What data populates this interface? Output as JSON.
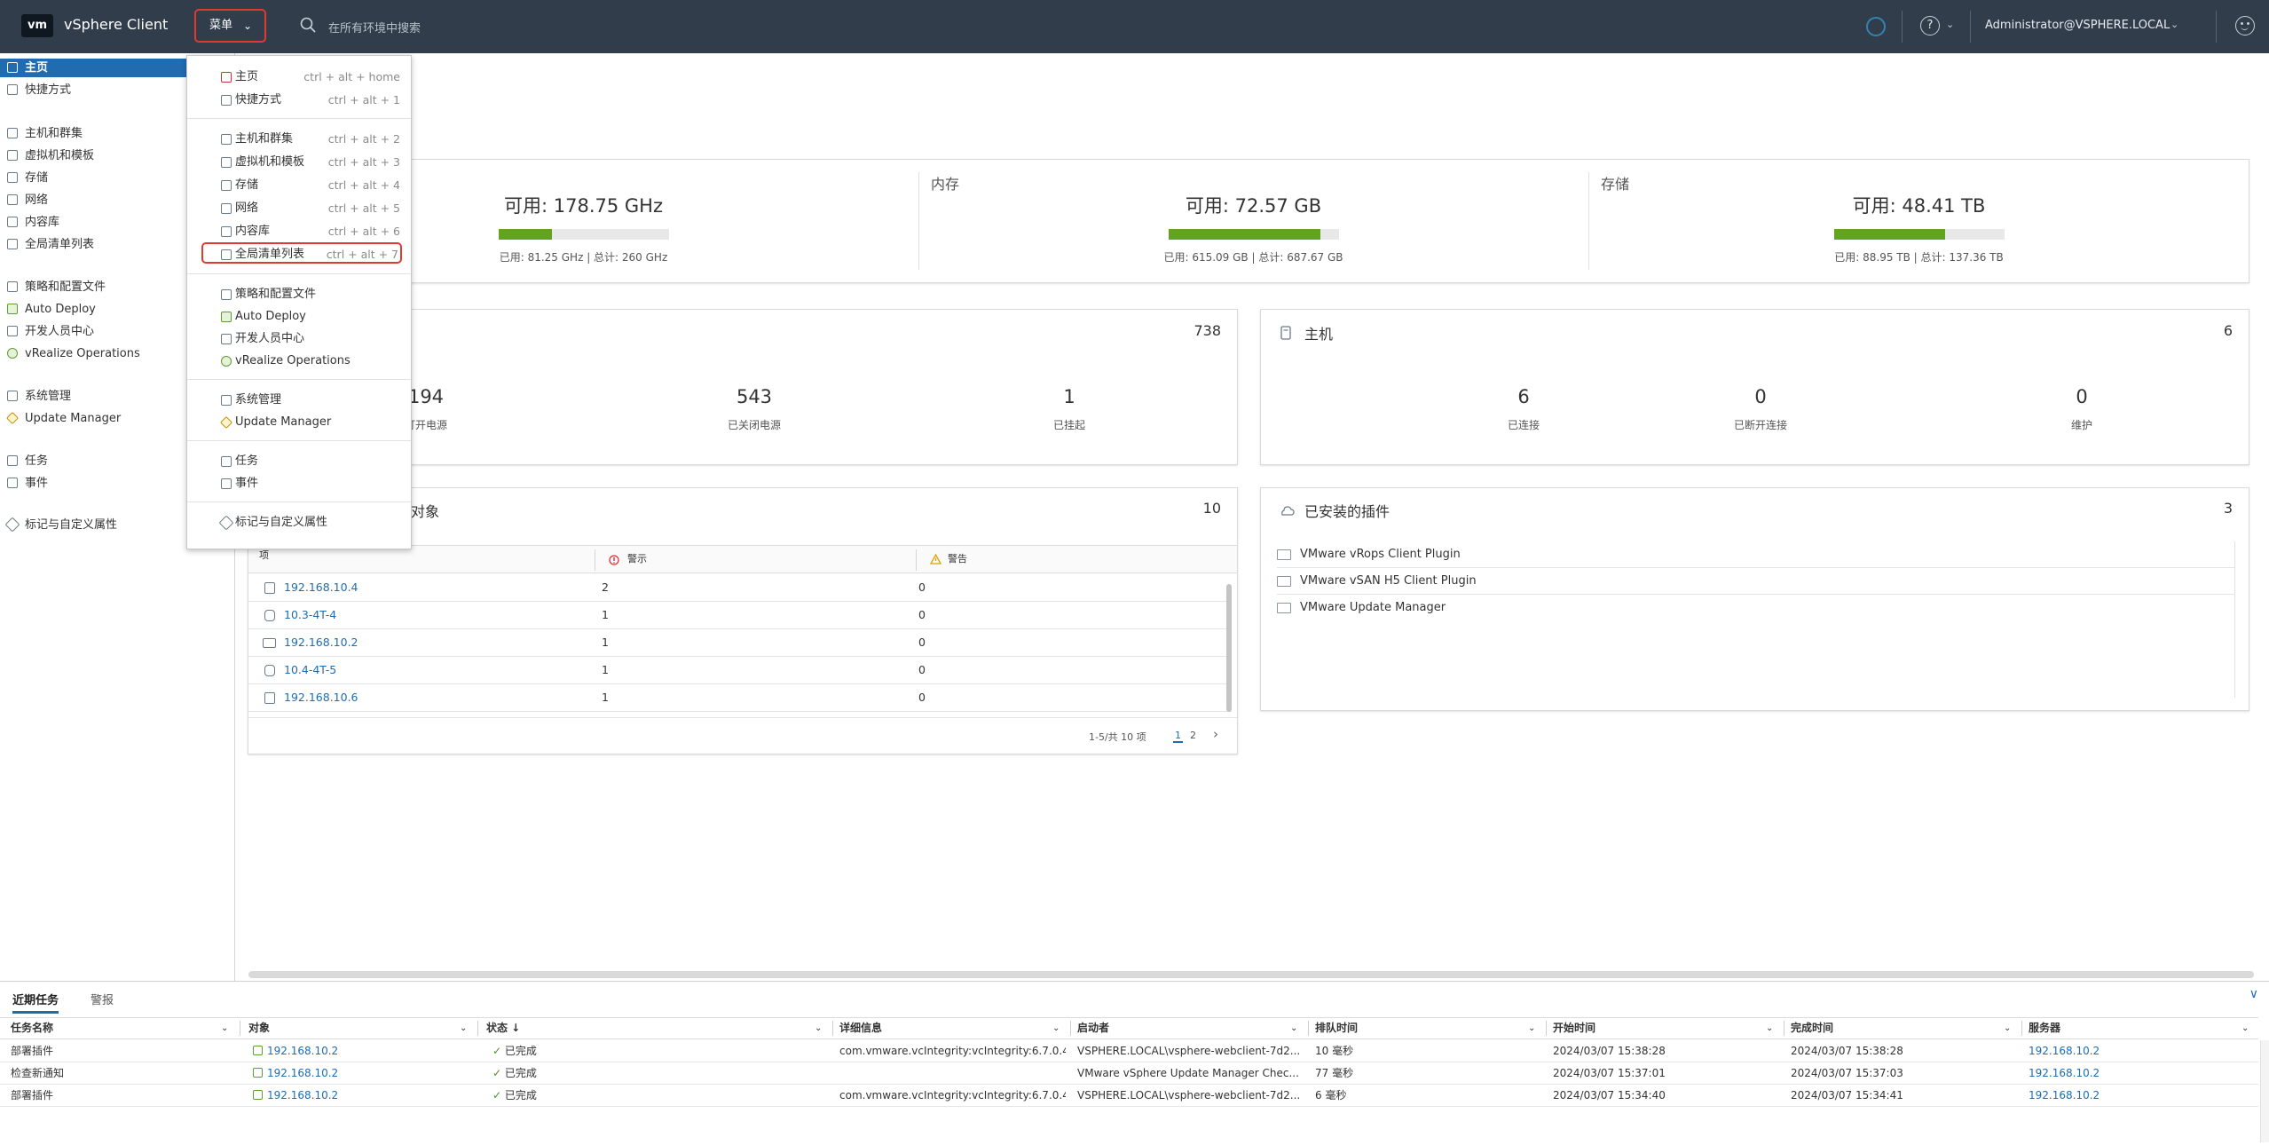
{
  "header": {
    "logo": "vm",
    "title": "vSphere Client",
    "menu_label": "菜单",
    "search_placeholder": "在所有环境中搜索",
    "user": "Administrator@VSPHERE.LOCAL",
    "help": "?"
  },
  "sidebar": {
    "items": [
      {
        "label": "主页"
      },
      {
        "label": "快捷方式"
      },
      {
        "label": "主机和群集"
      },
      {
        "label": "虚拟机和模板"
      },
      {
        "label": "存储"
      },
      {
        "label": "网络"
      },
      {
        "label": "内容库"
      },
      {
        "label": "全局清单列表"
      },
      {
        "label": "策略和配置文件"
      },
      {
        "label": "Auto Deploy"
      },
      {
        "label": "开发人员中心"
      },
      {
        "label": "vRealize Operations"
      },
      {
        "label": "系统管理"
      },
      {
        "label": "Update Manager"
      },
      {
        "label": "任务"
      },
      {
        "label": "事件"
      },
      {
        "label": "标记与自定义属性"
      }
    ]
  },
  "menu": {
    "items": [
      {
        "label": "主页",
        "shortcut": "ctrl + alt + home"
      },
      {
        "label": "快捷方式",
        "shortcut": "ctrl + alt + 1"
      },
      {
        "label": "主机和群集",
        "shortcut": "ctrl + alt + 2"
      },
      {
        "label": "虚拟机和模板",
        "shortcut": "ctrl + alt + 3"
      },
      {
        "label": "存储",
        "shortcut": "ctrl + alt + 4"
      },
      {
        "label": "网络",
        "shortcut": "ctrl + alt + 5"
      },
      {
        "label": "内容库",
        "shortcut": "ctrl + alt + 6"
      },
      {
        "label": "全局清单列表",
        "shortcut": "ctrl + alt + 7"
      },
      {
        "label": "策略和配置文件",
        "shortcut": ""
      },
      {
        "label": "Auto Deploy",
        "shortcut": ""
      },
      {
        "label": "开发人员中心",
        "shortcut": ""
      },
      {
        "label": "vRealize Operations",
        "shortcut": ""
      },
      {
        "label": "系统管理",
        "shortcut": ""
      },
      {
        "label": "Update Manager",
        "shortcut": ""
      },
      {
        "label": "任务",
        "shortcut": ""
      },
      {
        "label": "事件",
        "shortcut": ""
      },
      {
        "label": "标记与自定义属性",
        "shortcut": ""
      }
    ]
  },
  "resources": {
    "cpu": {
      "free": "可用: 178.75 GHz",
      "detail": "已用: 81.25 GHz | 总计: 260 GHz",
      "used_pct": 31
    },
    "memory": {
      "label": "内存",
      "free": "可用: 72.57 GB",
      "detail": "已用: 615.09 GB | 总计: 687.67 GB",
      "used_pct": 89
    },
    "storage": {
      "label": "存储",
      "free": "可用: 48.41 TB",
      "detail": "已用: 88.95 TB | 总计: 137.36 TB",
      "used_pct": 65
    }
  },
  "vms": {
    "count": "738",
    "stats": [
      {
        "value": "194",
        "label": "打开电源"
      },
      {
        "value": "543",
        "label": "已关闭电源"
      },
      {
        "value": "1",
        "label": "已挂起"
      }
    ]
  },
  "hosts": {
    "title": "主机",
    "count": "6",
    "stats": [
      {
        "value": "6",
        "label": "已连接"
      },
      {
        "value": "0",
        "label": "已断开连接"
      },
      {
        "value": "0",
        "label": "维护"
      }
    ]
  },
  "objects": {
    "title": "对象",
    "count": "10",
    "columns": [
      "项",
      "警示",
      "警告"
    ],
    "rows": [
      {
        "name": "192.168.10.4",
        "alerts": "2",
        "warnings": "0"
      },
      {
        "name": "10.3-4T-4",
        "alerts": "1",
        "warnings": "0"
      },
      {
        "name": "192.168.10.2",
        "alerts": "1",
        "warnings": "0"
      },
      {
        "name": "10.4-4T-5",
        "alerts": "1",
        "warnings": "0"
      },
      {
        "name": "192.168.10.6",
        "alerts": "1",
        "warnings": "0"
      }
    ],
    "pager_text": "1-5/共 10 项",
    "pages": [
      "1",
      "2"
    ]
  },
  "plugins": {
    "title": "已安装的插件",
    "count": "3",
    "items": [
      "VMware vRops Client Plugin",
      "VMware vSAN H5 Client Plugin",
      "VMware Update Manager"
    ]
  },
  "tasks": {
    "tabs": [
      "近期任务",
      "警报"
    ],
    "columns": [
      "任务名称",
      "对象",
      "状态 ↓",
      "详细信息",
      "启动者",
      "排队时间",
      "开始时间",
      "完成时间",
      "服务器"
    ],
    "rows": [
      {
        "name": "部署插件",
        "object": "192.168.10.2",
        "status": "已完成",
        "detail": "com.vmware.vcIntegrity:vcIntegrity:6.7.0.4...",
        "initiator": "VSPHERE.LOCAL\\vsphere-webclient-7d2...",
        "queued": "10 毫秒",
        "start": "2024/03/07 15:38:28",
        "end": "2024/03/07 15:38:28",
        "server": "192.168.10.2"
      },
      {
        "name": "检查新通知",
        "object": "192.168.10.2",
        "status": "已完成",
        "detail": "",
        "initiator": "VMware vSphere Update Manager Chec...",
        "queued": "77 毫秒",
        "start": "2024/03/07 15:37:01",
        "end": "2024/03/07 15:37:03",
        "server": "192.168.10.2"
      },
      {
        "name": "部署插件",
        "object": "192.168.10.2",
        "status": "已完成",
        "detail": "com.vmware.vcIntegrity:vcIntegrity:6.7.0.4...",
        "initiator": "VSPHERE.LOCAL\\vsphere-webclient-7d2...",
        "queued": "6 毫秒",
        "start": "2024/03/07 15:34:40",
        "end": "2024/03/07 15:34:41",
        "server": "192.168.10.2"
      }
    ]
  },
  "colors": {
    "header_bg": "#313d4b",
    "accent": "#1f6cb1",
    "highlight": "#e03a2f",
    "bar_green": "#62a420"
  }
}
